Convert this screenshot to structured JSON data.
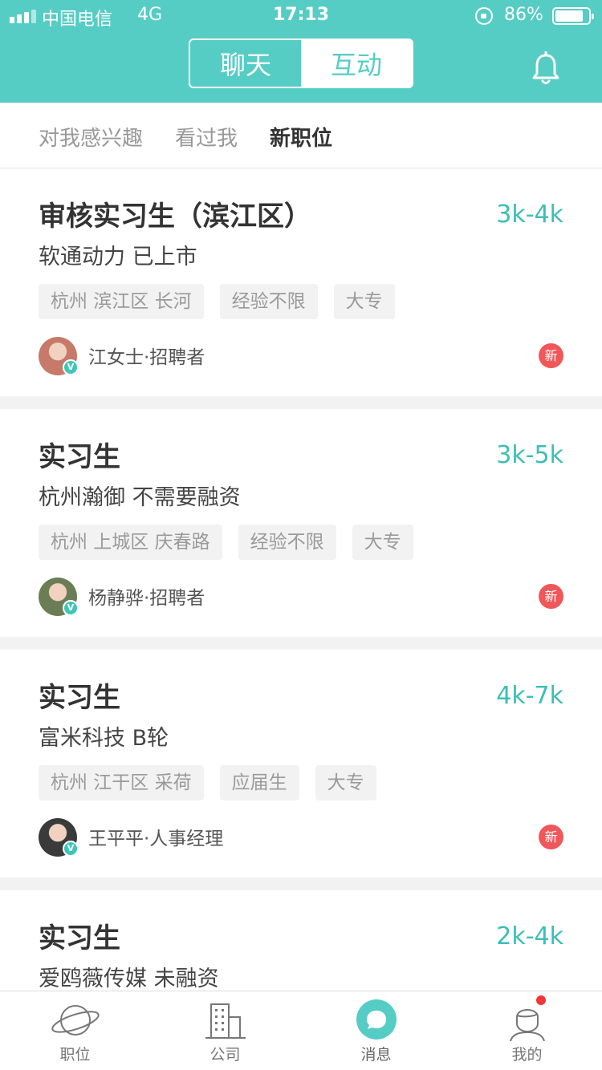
{
  "status_bar": {
    "carrier": "中国电信",
    "network": "4G",
    "time": "17:13",
    "battery": "86%",
    "battery_level": 0.86
  },
  "header": {
    "tabs": [
      {
        "label": "聊天",
        "active": false
      },
      {
        "label": "互动",
        "active": true
      }
    ],
    "bell_icon": "bell-icon"
  },
  "sub_tabs": [
    {
      "label": "对我感兴趣",
      "active": false
    },
    {
      "label": "看过我",
      "active": false
    },
    {
      "label": "新职位",
      "active": true
    }
  ],
  "jobs": [
    {
      "title": "审核实习生（滨江区）",
      "salary": "3k-4k",
      "company": "软通动力 已上市",
      "tags": [
        "杭州 滨江区 长河",
        "经验不限",
        "大专"
      ],
      "recruiter": "江女士·招聘者",
      "avatar_color": "#c77a6a",
      "badge": "新",
      "verified": "V"
    },
    {
      "title": "实习生",
      "salary": "3k-5k",
      "company": "杭州瀚御 不需要融资",
      "tags": [
        "杭州 上城区 庆春路",
        "经验不限",
        "大专"
      ],
      "recruiter": "杨静骅·招聘者",
      "avatar_color": "#6b7d55",
      "badge": "新",
      "verified": "V"
    },
    {
      "title": "实习生",
      "salary": "4k-7k",
      "company": "富米科技 B轮",
      "tags": [
        "杭州 江干区 采荷",
        "应届生",
        "大专"
      ],
      "recruiter": "王平平·人事经理",
      "avatar_color": "#3a3a3a",
      "badge": "新",
      "verified": "V"
    },
    {
      "title": "实习生",
      "salary": "2k-4k",
      "company": "爱鸥薇传媒 未融资",
      "tags": [],
      "recruiter": "",
      "badge": "",
      "verified": ""
    }
  ],
  "bottom_nav": [
    {
      "label": "职位",
      "icon": "planet-icon"
    },
    {
      "label": "公司",
      "icon": "building-icon"
    },
    {
      "label": "消息",
      "icon": "message-bubble-icon",
      "active": true
    },
    {
      "label": "我的",
      "icon": "profile-icon",
      "has_dot": true
    }
  ],
  "colors": {
    "brand": "#56cdc4",
    "salary": "#3bbfb6",
    "new_badge": "#f0575a"
  }
}
